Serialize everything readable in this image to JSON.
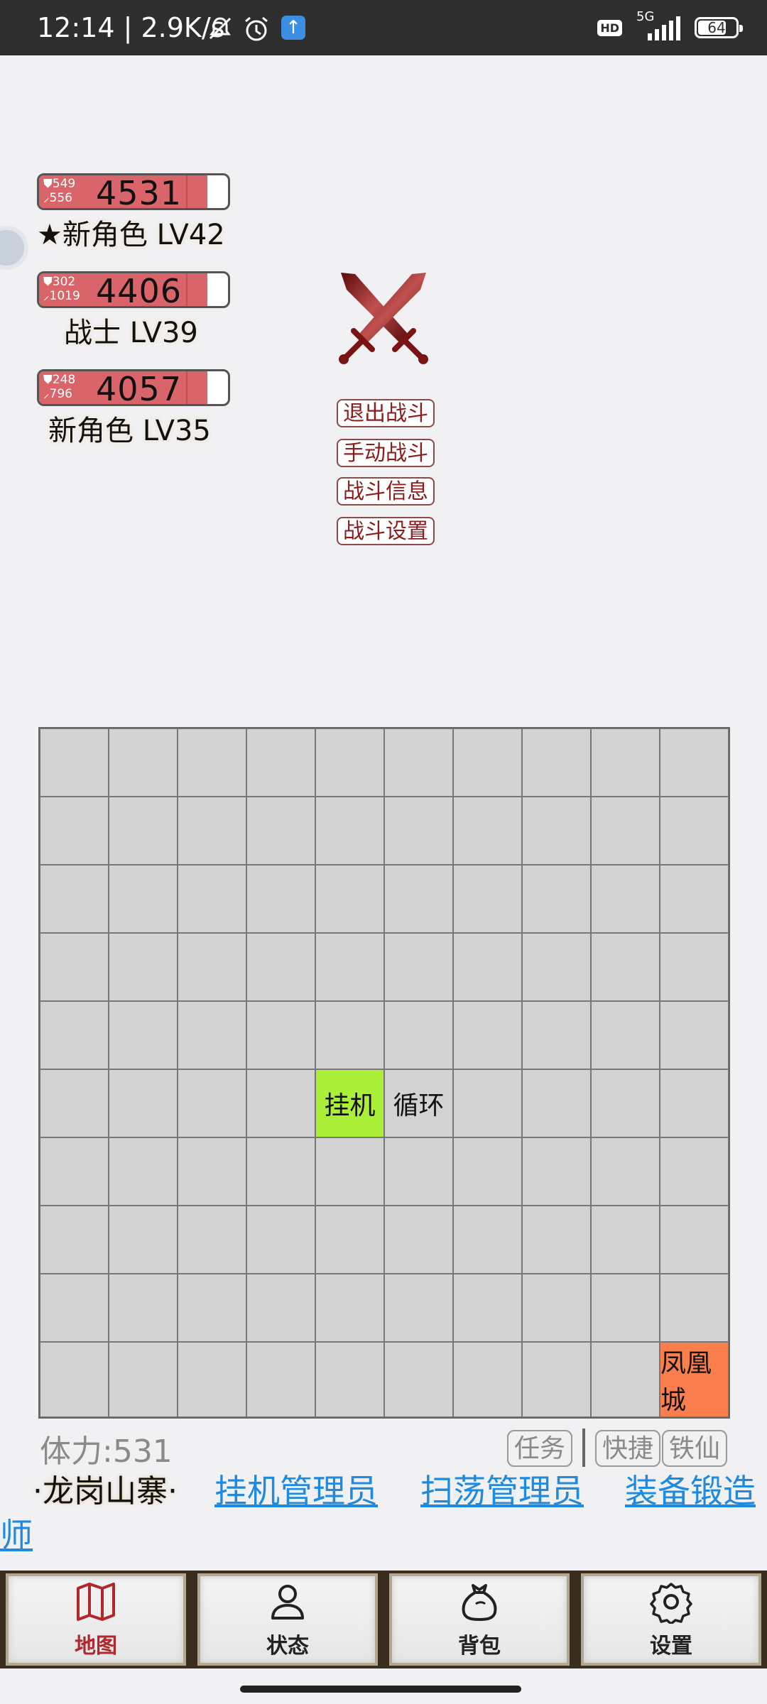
{
  "status_bar": {
    "time_speed": "12:14 | 2.9K/s",
    "hd": "HD",
    "network": "5G",
    "battery": "64"
  },
  "characters": [
    {
      "shield": "549",
      "attack": "556",
      "hp": "4531",
      "hp_fraction": 0.89,
      "name": "★新角色 LV42"
    },
    {
      "shield": "302",
      "attack": "1019",
      "hp": "4406",
      "hp_fraction": 0.89,
      "name": "战士 LV39"
    },
    {
      "shield": "248",
      "attack": "796",
      "hp": "4057",
      "hp_fraction": 0.89,
      "name": "新角色 LV35"
    }
  ],
  "battle_menu": [
    "退出战斗",
    "手动战斗",
    "战斗信息",
    "战斗设置"
  ],
  "map": {
    "rows": 10,
    "cols": 10,
    "cells": [
      {
        "row": 6,
        "col": 5,
        "label": "挂机",
        "color": "#acef38"
      },
      {
        "row": 6,
        "col": 6,
        "label": "循环",
        "color": ""
      },
      {
        "row": 10,
        "col": 10,
        "label": "凤凰城",
        "color": "#fb7f4c"
      }
    ]
  },
  "stamina": "体力:531",
  "quick_buttons": [
    "任务",
    "快捷",
    "铁仙"
  ],
  "location": "·龙岗山寨·",
  "links": [
    "挂机管理员",
    "扫荡管理员",
    "装备锻造",
    "师"
  ],
  "nav": [
    {
      "label": "地图",
      "icon": "map-icon",
      "active": true
    },
    {
      "label": "状态",
      "icon": "person-icon",
      "active": false
    },
    {
      "label": "背包",
      "icon": "bag-icon",
      "active": false
    },
    {
      "label": "设置",
      "icon": "gear-icon",
      "active": false
    }
  ],
  "colors": {
    "accent": "#b0282c",
    "link": "#1e8ae0",
    "hp": "#d96469"
  }
}
